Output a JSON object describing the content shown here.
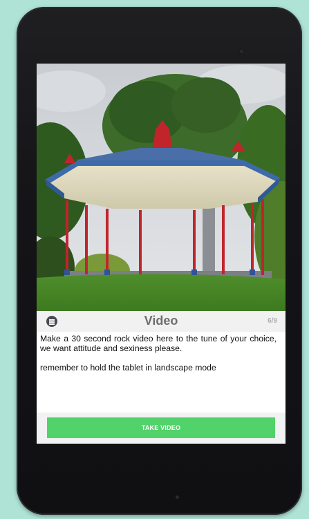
{
  "question": {
    "title": "Video",
    "progress": "6/9",
    "paragraphs": [
      "Make a 30 second rock video here to the tune of your choice, we want attitude and sexiness please.",
      "remember to hold the tablet in landscape mode"
    ]
  },
  "actions": {
    "take_video_label": "TAKE VIDEO"
  },
  "colors": {
    "accent_green": "#52d26a",
    "background": "#aee3d6",
    "tablet_bezel": "#141416"
  },
  "icons": {
    "menu": "menu-icon"
  }
}
